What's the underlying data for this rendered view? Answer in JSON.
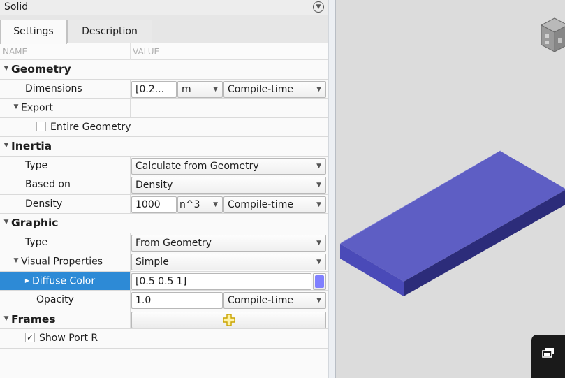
{
  "panel": {
    "title": "Solid",
    "tabs": [
      {
        "label": "Settings",
        "active": true
      },
      {
        "label": "Description",
        "active": false
      }
    ],
    "columns": {
      "name": "NAME",
      "value": "VALUE"
    }
  },
  "tree": {
    "geometry": {
      "label": "Geometry",
      "dimensions": {
        "label": "Dimensions",
        "value": "[0.2...",
        "unit": "m",
        "config": "Compile-time"
      },
      "export": {
        "label": "Export",
        "entire_geometry": {
          "label": "Entire Geometry",
          "checked": false
        }
      }
    },
    "inertia": {
      "label": "Inertia",
      "type": {
        "label": "Type",
        "value": "Calculate from Geometry"
      },
      "based_on": {
        "label": "Based on",
        "value": "Density"
      },
      "density": {
        "label": "Density",
        "value": "1000",
        "unit": "n^3",
        "config": "Compile-time"
      }
    },
    "graphic": {
      "label": "Graphic",
      "type": {
        "label": "Type",
        "value": "From Geometry"
      },
      "visual_properties": {
        "label": "Visual Properties",
        "value": "Simple"
      },
      "diffuse_color": {
        "label": "Diffuse Color",
        "value": "[0.5 0.5 1]",
        "swatch": "#8080ff"
      },
      "opacity": {
        "label": "Opacity",
        "value": "1.0",
        "config": "Compile-time"
      }
    },
    "frames": {
      "label": "Frames",
      "show_port_r": {
        "label": "Show Port R",
        "checked": true,
        "check_mark": "✓"
      }
    }
  },
  "viewport": {
    "background": "#dcdcdc",
    "solid_color": "#5555c8"
  },
  "icons": {
    "collapse": "collapse-icon",
    "add_frame": "add-frame-icon",
    "view_cube": "view-cube-icon",
    "toolbar": "layers-icon"
  }
}
